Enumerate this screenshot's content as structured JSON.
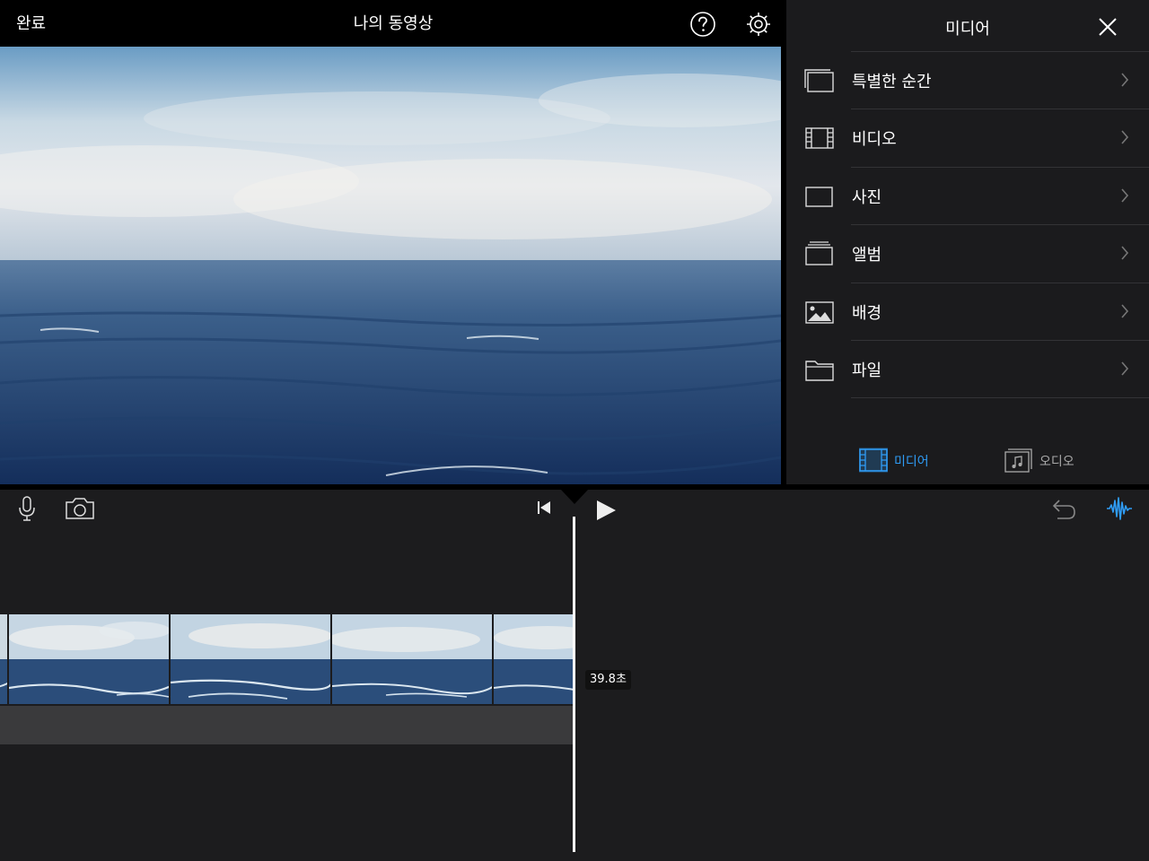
{
  "topbar": {
    "done_label": "완료",
    "project_title": "나의 동영상"
  },
  "media_panel": {
    "title": "미디어",
    "items": [
      {
        "label": "특별한 순간",
        "icon": "moments-icon"
      },
      {
        "label": "비디오",
        "icon": "film-icon"
      },
      {
        "label": "사진",
        "icon": "photo-icon"
      },
      {
        "label": "앨범",
        "icon": "album-icon"
      },
      {
        "label": "배경",
        "icon": "background-icon"
      },
      {
        "label": "파일",
        "icon": "folder-icon"
      }
    ],
    "tabs": [
      {
        "label": "미디어",
        "icon": "media-tab-icon",
        "selected": true
      },
      {
        "label": "오디오",
        "icon": "audio-tab-icon",
        "selected": false
      }
    ]
  },
  "timeline": {
    "duration_label": "39.8초"
  },
  "colors": {
    "accent": "#2f9df7",
    "panel_bg": "#1b1b1d",
    "timeline_bg": "#1c1c1e",
    "audio_track": "#3a3a3c"
  }
}
